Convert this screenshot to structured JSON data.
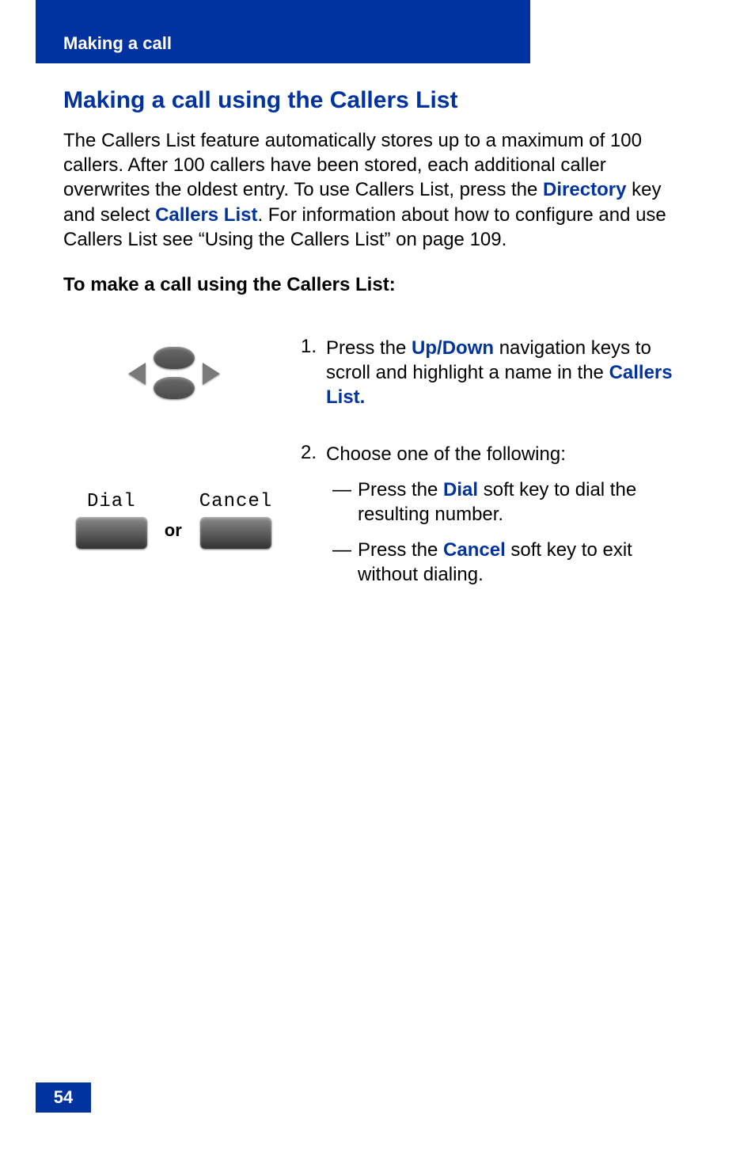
{
  "header": {
    "section": "Making a call"
  },
  "title": "Making a call using the Callers List",
  "intro": {
    "p1a": "The Callers List feature automatically stores up to a maximum of 100 callers. After 100 callers have been stored, each additional caller overwrites the oldest entry. To use Callers List, press the ",
    "directory": "Directory",
    "p1b": " key and select ",
    "callers_list": "Callers List",
    "p1c": ". For information about how to configure and use Callers List see “Using the Callers List” on page 109."
  },
  "subhead": "To make a call using the Callers List:",
  "softkeys": {
    "dial": "Dial",
    "cancel": "Cancel",
    "or": "or"
  },
  "steps": {
    "s1": {
      "num": "1.",
      "a": "Press the ",
      "updown": "Up/Down",
      "b": " navigation keys to scroll and highlight a name in the ",
      "callers_list": "Callers List."
    },
    "s2": {
      "num": "2.",
      "lead": "Choose one of the following:",
      "dash": "—",
      "opt1a": "Press the ",
      "dial": "Dial",
      "opt1b": " soft key to dial the resulting number.",
      "opt2a": "Press the ",
      "cancel": "Cancel",
      "opt2b": " soft key to exit without dialing."
    }
  },
  "page_number": "54"
}
